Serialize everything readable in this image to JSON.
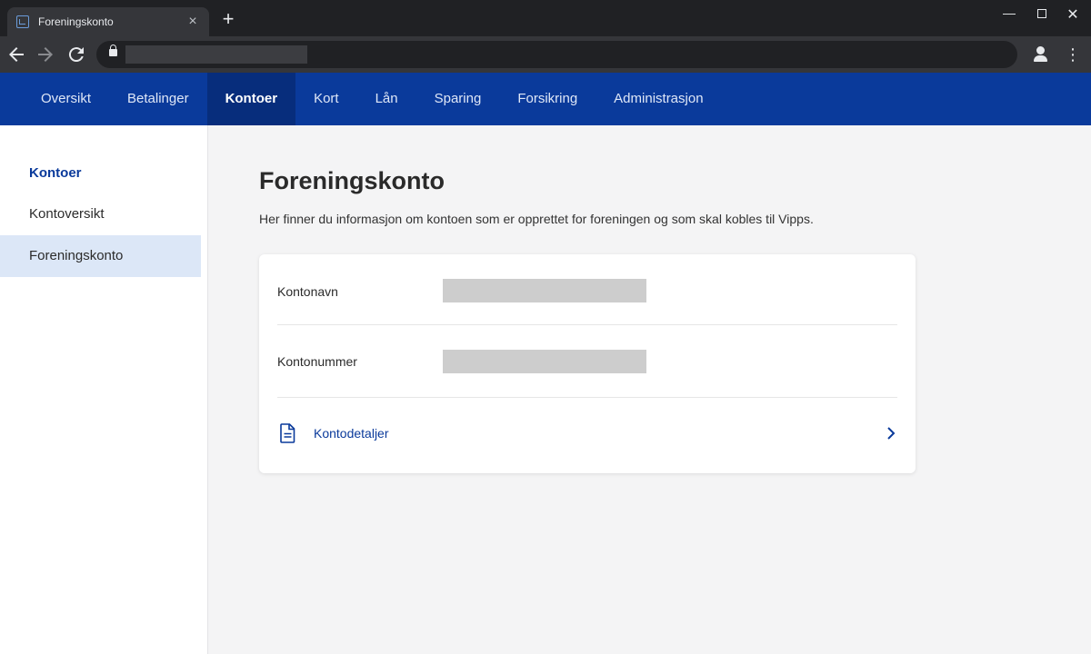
{
  "browser": {
    "tab_title": "Foreningskonto",
    "new_tab_symbol": "+",
    "close_symbol": "×"
  },
  "site_nav": {
    "items": [
      "Oversikt",
      "Betalinger",
      "Kontoer",
      "Kort",
      "Lån",
      "Sparing",
      "Forsikring",
      "Administrasjon"
    ],
    "active": "Kontoer"
  },
  "sidebar": {
    "heading": "Kontoer",
    "items": [
      "Kontoversikt",
      "Foreningskonto"
    ],
    "active": "Foreningskonto"
  },
  "main": {
    "title": "Foreningskonto",
    "subtitle": "Her finner du informasjon om kontoen som er opprettet for foreningen og som skal kobles til Vipps.",
    "fields": [
      {
        "label": "Kontonavn"
      },
      {
        "label": "Kontonummer"
      }
    ],
    "details_link": "Kontodetaljer"
  },
  "colors": {
    "brand_blue": "#0a3a9b",
    "nav_active": "#072d7c",
    "sidebar_active": "#dce7f7"
  },
  "icons": [
    "back-arrow-icon",
    "forward-arrow-icon",
    "reload-icon",
    "lock-icon",
    "profile-icon",
    "menu-kebab-icon",
    "document-icon",
    "chevron-right-icon"
  ]
}
